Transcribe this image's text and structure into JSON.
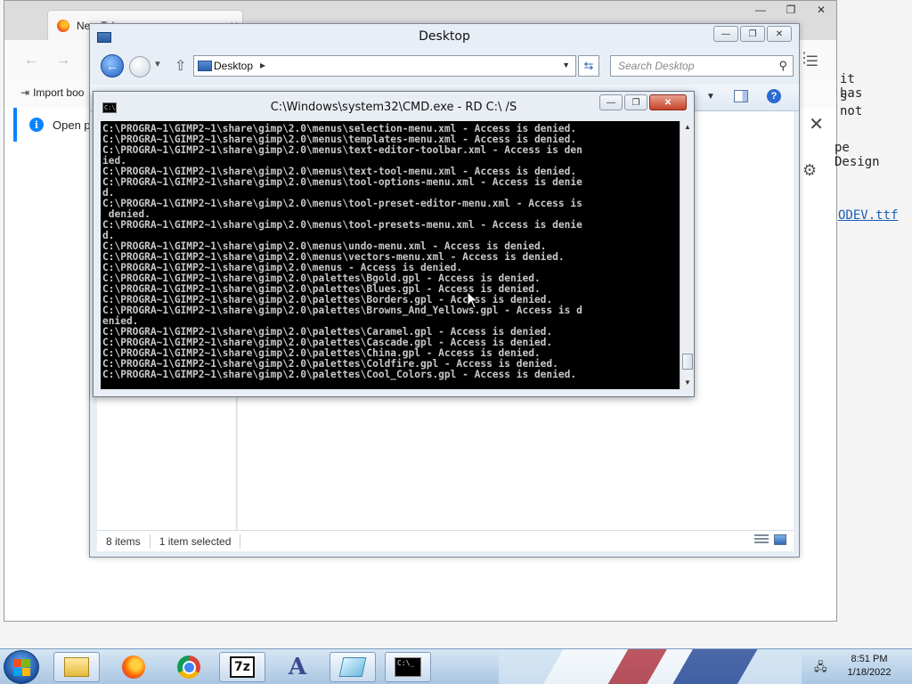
{
  "browser": {
    "tab_title": "New Tab",
    "tab_close": "✕",
    "window_controls": {
      "minimize": "—",
      "maximize": "❐",
      "close": "✕"
    },
    "bookmark_label": "Import boo",
    "notice_text": "Open pre",
    "notice_close": "✕",
    "page_fragments": {
      "line1": "it has",
      "line2": "s not",
      "line3": "pe Design",
      "link": "ODEV.ttf"
    }
  },
  "explorer": {
    "title": "Desktop",
    "window_controls": {
      "minimize": "—",
      "maximize": "❐",
      "close": "✕"
    },
    "address": "Desktop",
    "search_placeholder": "Search Desktop",
    "help": "?",
    "status": {
      "items": "8 items",
      "selected": "1 item selected"
    }
  },
  "cmd": {
    "title": "C:\\Windows\\system32\\CMD.exe - RD  C:\\ /S",
    "window_controls": {
      "minimize": "—",
      "maximize": "❐",
      "close": "✕"
    },
    "icon_text": "C:\\",
    "lines": [
      "C:\\PROGRA~1\\GIMP2~1\\share\\gimp\\2.0\\menus\\selection-menu.xml - Access is denied.",
      "C:\\PROGRA~1\\GIMP2~1\\share\\gimp\\2.0\\menus\\templates-menu.xml - Access is denied.",
      "C:\\PROGRA~1\\GIMP2~1\\share\\gimp\\2.0\\menus\\text-editor-toolbar.xml - Access is den",
      "ied.",
      "C:\\PROGRA~1\\GIMP2~1\\share\\gimp\\2.0\\menus\\text-tool-menu.xml - Access is denied.",
      "C:\\PROGRA~1\\GIMP2~1\\share\\gimp\\2.0\\menus\\tool-options-menu.xml - Access is denie",
      "d.",
      "C:\\PROGRA~1\\GIMP2~1\\share\\gimp\\2.0\\menus\\tool-preset-editor-menu.xml - Access is",
      " denied.",
      "C:\\PROGRA~1\\GIMP2~1\\share\\gimp\\2.0\\menus\\tool-presets-menu.xml - Access is denie",
      "d.",
      "C:\\PROGRA~1\\GIMP2~1\\share\\gimp\\2.0\\menus\\undo-menu.xml - Access is denied.",
      "C:\\PROGRA~1\\GIMP2~1\\share\\gimp\\2.0\\menus\\vectors-menu.xml - Access is denied.",
      "C:\\PROGRA~1\\GIMP2~1\\share\\gimp\\2.0\\menus - Access is denied.",
      "C:\\PROGRA~1\\GIMP2~1\\share\\gimp\\2.0\\palettes\\Bgold.gpl - Access is denied.",
      "C:\\PROGRA~1\\GIMP2~1\\share\\gimp\\2.0\\palettes\\Blues.gpl - Access is denied.",
      "C:\\PROGRA~1\\GIMP2~1\\share\\gimp\\2.0\\palettes\\Borders.gpl - Access is denied.",
      "C:\\PROGRA~1\\GIMP2~1\\share\\gimp\\2.0\\palettes\\Browns_And_Yellows.gpl - Access is d",
      "enied.",
      "C:\\PROGRA~1\\GIMP2~1\\share\\gimp\\2.0\\palettes\\Caramel.gpl - Access is denied.",
      "C:\\PROGRA~1\\GIMP2~1\\share\\gimp\\2.0\\palettes\\Cascade.gpl - Access is denied.",
      "C:\\PROGRA~1\\GIMP2~1\\share\\gimp\\2.0\\palettes\\China.gpl - Access is denied.",
      "C:\\PROGRA~1\\GIMP2~1\\share\\gimp\\2.0\\palettes\\Coldfire.gpl - Access is denied.",
      "C:\\PROGRA~1\\GIMP2~1\\share\\gimp\\2.0\\palettes\\Cool_Colors.gpl - Access is denied."
    ]
  },
  "taskbar": {
    "apps": [
      "explorer",
      "firefox",
      "chrome",
      "7zip",
      "font-viewer",
      "notepad",
      "cmd"
    ],
    "seven_zip_label": "7z",
    "cmd_icon_text": "C:\\_",
    "clock_time": "8:51 PM",
    "clock_date": "1/18/2022"
  },
  "colors": {
    "firefox_notice_accent": "#0a84ff",
    "console_bg": "#000000",
    "console_text": "#c8c8c8",
    "close_button": "#c7432b"
  }
}
